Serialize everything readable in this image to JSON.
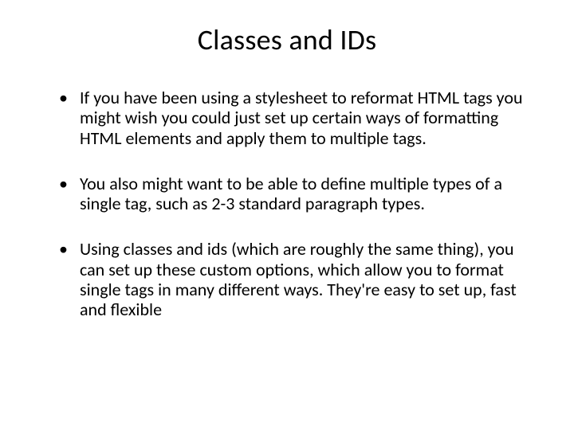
{
  "slide": {
    "title": "Classes and IDs",
    "bullets": [
      "If you have been using a stylesheet to reformat HTML tags you might wish you could just set up certain ways of formatting HTML elements and apply them to multiple tags.",
      "You also might want to be able to define multiple types of a single tag, such as 2-3 standard paragraph types.",
      "Using classes and ids (which are roughly the same thing), you can set up these custom options, which allow you to format single tags in many different ways. They're easy to set up, fast and flexible"
    ]
  }
}
